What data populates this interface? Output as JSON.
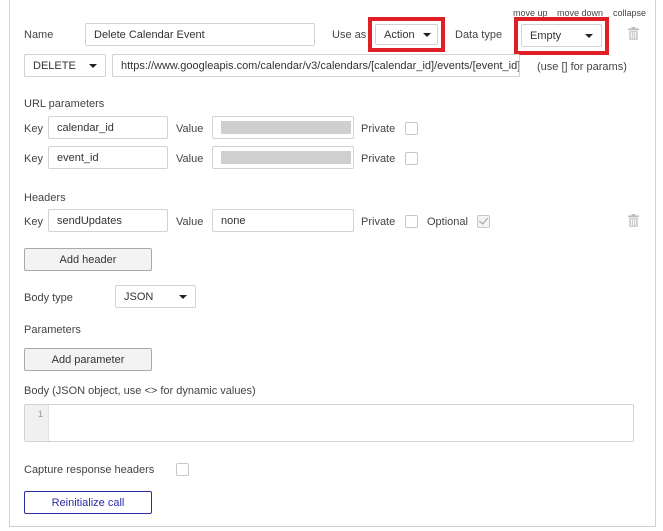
{
  "header_controls": {
    "move_up": "move up",
    "move_down": "move down",
    "collapse": "collapse"
  },
  "call": {
    "name_label": "Name",
    "name_value": "Delete Calendar Event",
    "use_as_label": "Use as",
    "use_as_value": "Action",
    "data_type_label": "Data type",
    "data_type_value": "Empty",
    "method": "DELETE",
    "url": "https://www.googleapis.com/calendar/v3/calendars/[calendar_id]/events/[event_id]",
    "url_hint": "(use [] for params)"
  },
  "url_parameters": {
    "section_title": "URL parameters",
    "key_label": "Key",
    "value_label": "Value",
    "private_label": "Private",
    "rows": [
      {
        "key": "calendar_id",
        "private": false
      },
      {
        "key": "event_id",
        "private": false
      }
    ]
  },
  "headers": {
    "section_title": "Headers",
    "key_label": "Key",
    "value_label": "Value",
    "private_label": "Private",
    "optional_label": "Optional",
    "rows": [
      {
        "key": "sendUpdates",
        "value": "none",
        "private": false,
        "optional": true
      }
    ],
    "add_button": "Add header"
  },
  "body_type": {
    "label": "Body type",
    "value": "JSON"
  },
  "parameters": {
    "section_title": "Parameters",
    "add_button": "Add parameter"
  },
  "body": {
    "label": "Body (JSON object, use <> for dynamic values)",
    "line_numbers": [
      "1"
    ],
    "content": ""
  },
  "capture_response_headers": {
    "label": "Capture response headers",
    "checked": false
  },
  "reinitialize_button": "Reinitialize call",
  "colors": {
    "highlight": "#e01e26",
    "primary_button": "#2c2ca8",
    "border": "#d2d2d2"
  },
  "icons": {
    "delete": "trash-icon",
    "dropdown": "caret-down-icon",
    "check": "check-icon"
  }
}
